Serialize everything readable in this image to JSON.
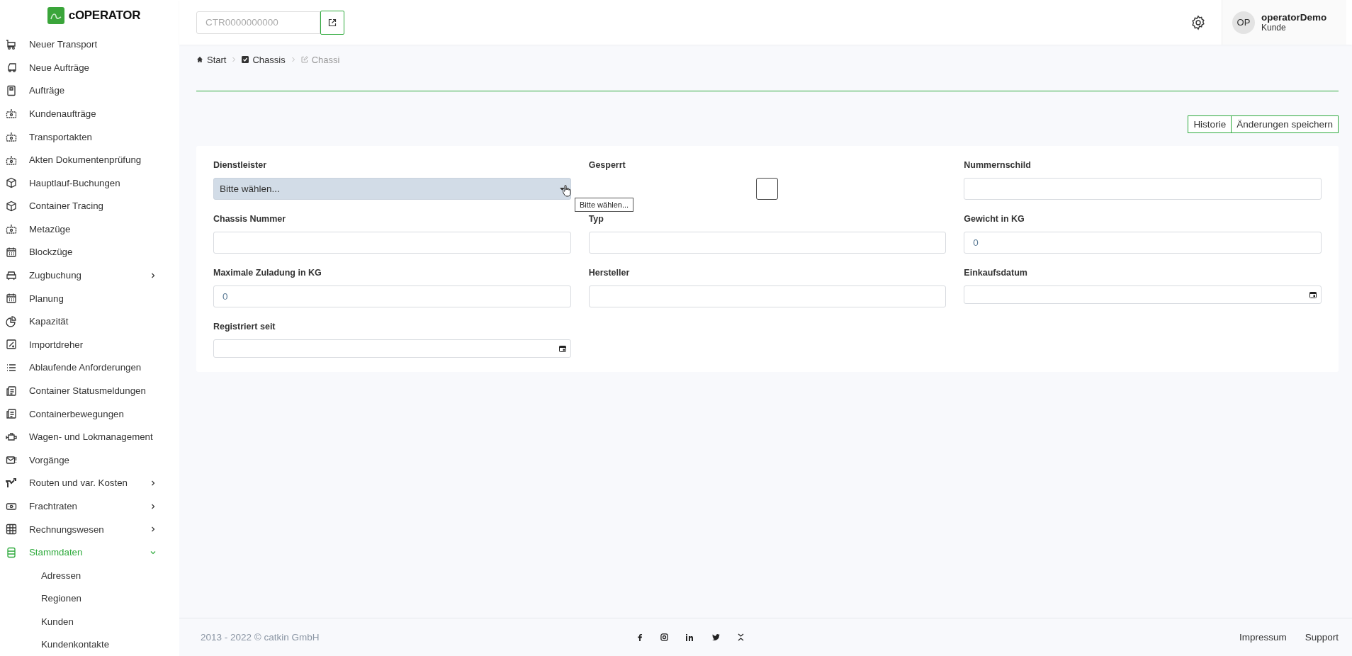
{
  "logo": {
    "text": "cOPERATOR"
  },
  "sidebar": {
    "items": [
      {
        "label": "Neuer Transport",
        "kind": "link",
        "selected": false
      },
      {
        "label": "Neue Aufträge",
        "kind": "link",
        "selected": false
      },
      {
        "label": "Aufträge",
        "kind": "link",
        "selected": false
      },
      {
        "label": "Kundenaufträge",
        "kind": "link",
        "selected": false
      },
      {
        "label": "Transportakten",
        "kind": "link",
        "selected": false
      },
      {
        "label": "Akten Dokumentenprüfung",
        "kind": "link",
        "selected": false
      },
      {
        "label": "Hauptlauf-Buchungen",
        "kind": "link",
        "selected": false
      },
      {
        "label": "Container Tracing",
        "kind": "link",
        "selected": false
      },
      {
        "label": "Metazüge",
        "kind": "link",
        "selected": false
      },
      {
        "label": "Blockzüge",
        "kind": "link",
        "selected": false
      },
      {
        "label": "Zugbuchung",
        "kind": "group",
        "selected": false,
        "expanded": false
      },
      {
        "label": "Planung",
        "kind": "link",
        "selected": false
      },
      {
        "label": "Kapazität",
        "kind": "link",
        "selected": false
      },
      {
        "label": "Importdreher",
        "kind": "link",
        "selected": false
      },
      {
        "label": "Ablaufende Anforderungen",
        "kind": "link",
        "selected": false
      },
      {
        "label": "Container Statusmeldungen",
        "kind": "link",
        "selected": false
      },
      {
        "label": "Containerbewegungen",
        "kind": "link",
        "selected": false
      },
      {
        "label": "Wagen- und Lokmanagement",
        "kind": "link",
        "selected": false
      },
      {
        "label": "Vorgänge",
        "kind": "link",
        "selected": false
      },
      {
        "label": "Routen und var. Kosten",
        "kind": "group",
        "selected": false,
        "expanded": false
      },
      {
        "label": "Frachtraten",
        "kind": "group",
        "selected": false,
        "expanded": false
      },
      {
        "label": "Rechnungswesen",
        "kind": "group",
        "selected": false,
        "expanded": false
      },
      {
        "label": "Stammdaten",
        "kind": "group",
        "selected": true,
        "expanded": true,
        "children": [
          {
            "label": "Adressen",
            "selected": false
          },
          {
            "label": "Regionen",
            "selected": false
          },
          {
            "label": "Kunden",
            "selected": false
          },
          {
            "label": "Kundenkontakte",
            "selected": false
          }
        ]
      }
    ]
  },
  "header": {
    "search": {
      "placeholder": "CTR0000000000"
    },
    "user": {
      "initials": "OP",
      "name": "operatorDemo",
      "role": "Kunde"
    }
  },
  "breadcrumb": [
    {
      "label": "Start",
      "current": false
    },
    {
      "label": "Chassis",
      "current": false
    },
    {
      "label": "Chassi",
      "current": true
    }
  ],
  "actions": [
    "Historie",
    "Änderungen speichern"
  ],
  "form": {
    "fields": [
      {
        "label": "Dienstleister",
        "kind": "select",
        "value": "Bitte wählen...",
        "tooltip": "Bitte wählen..."
      },
      {
        "label": "Gesperrt",
        "kind": "checkbox",
        "checked": false
      },
      {
        "label": "Nummernschild",
        "kind": "text"
      },
      {
        "label": "Chassis Nummer",
        "kind": "text"
      },
      {
        "label": "Typ",
        "kind": "text"
      },
      {
        "label": "Gewicht in KG",
        "kind": "text",
        "value": "0"
      },
      {
        "label": "Maximale Zuladung in KG",
        "kind": "text",
        "value": "0"
      },
      {
        "label": "Hersteller",
        "kind": "text"
      },
      {
        "label": "Einkaufsdatum",
        "kind": "date"
      },
      {
        "label": "Registriert seit",
        "kind": "date"
      }
    ]
  },
  "footer": {
    "copyright": "2013 - 2022 © catkin GmbH",
    "links": [
      "Impressum",
      "Support"
    ]
  }
}
